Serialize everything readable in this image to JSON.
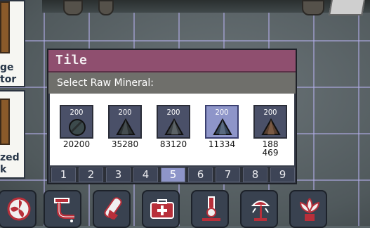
{
  "dialog": {
    "title": "Tile",
    "subtitle": "Select Raw Mineral:",
    "minerals": [
      {
        "amount": "200",
        "label": "20200",
        "icon": "round-rock-icon",
        "color": "#3c4a4c",
        "selected": false
      },
      {
        "amount": "200",
        "label": "35280",
        "icon": "triangle-rock-icon",
        "color": "#2e3436",
        "selected": false
      },
      {
        "amount": "200",
        "label": "83120",
        "icon": "triangle-rock-icon",
        "color": "#3e4447",
        "selected": false
      },
      {
        "amount": "200",
        "label": "11334",
        "icon": "triangle-rock-icon",
        "color": "#3a4a5e",
        "selected": true
      },
      {
        "amount": "200",
        "label": "188469",
        "icon": "triangle-rock-icon",
        "color": "#5a4030",
        "selected": false
      }
    ],
    "pages": [
      "1",
      "2",
      "3",
      "4",
      "5",
      "6",
      "7",
      "8",
      "9"
    ],
    "active_page": "5"
  },
  "side_menu": {
    "item1_text": "ge\ntor",
    "item2_text": "zed\nk"
  },
  "toolbar": {
    "items": [
      "ventilation-icon",
      "plumbing-icon",
      "medicine-icon",
      "medical-icon",
      "research-icon",
      "lighting-icon",
      "decor-icon"
    ]
  },
  "colors": {
    "title_bar": "#8f4f6f",
    "selected_tile": "#8e95c9",
    "tile": "#4a5068"
  }
}
